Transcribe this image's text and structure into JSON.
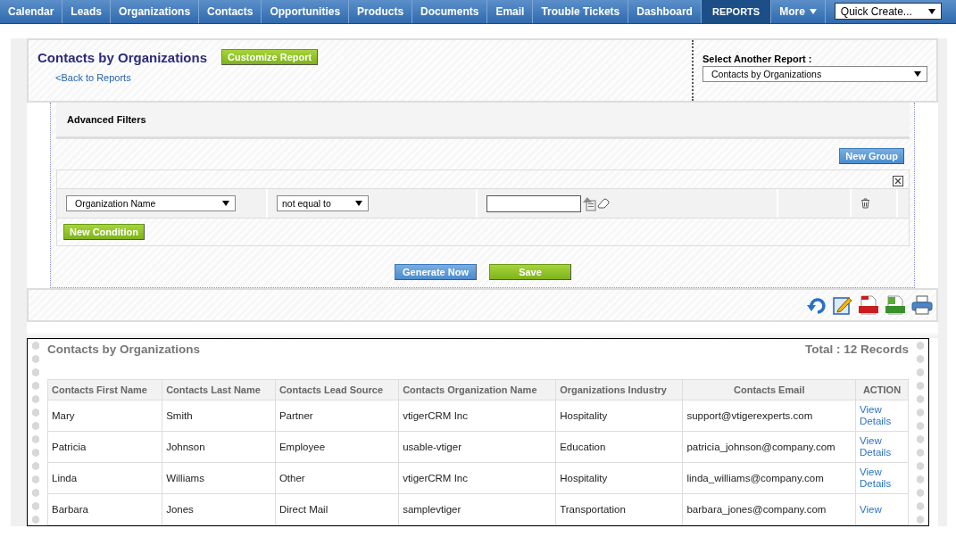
{
  "nav": {
    "items": [
      {
        "label": "Calendar",
        "selected": false
      },
      {
        "label": "Leads",
        "selected": false
      },
      {
        "label": "Organizations",
        "selected": false
      },
      {
        "label": "Contacts",
        "selected": false
      },
      {
        "label": "Opportunities",
        "selected": false
      },
      {
        "label": "Products",
        "selected": false
      },
      {
        "label": "Documents",
        "selected": false
      },
      {
        "label": "Email",
        "selected": false
      },
      {
        "label": "Trouble Tickets",
        "selected": false
      },
      {
        "label": "Dashboard",
        "selected": false
      },
      {
        "label": "REPORTS",
        "selected": true
      }
    ],
    "more": "More",
    "quick_create": "Quick Create..."
  },
  "report": {
    "title": "Contacts by Organizations",
    "customize_button": "Customize Report",
    "back_link": "<Back to Reports",
    "select_label": "Select Another Report :",
    "select_value": "Contacts by Organizations"
  },
  "filters": {
    "heading": "Advanced Filters",
    "new_group_button": "New Group",
    "conditions": [
      {
        "field": "Organization Name",
        "operator": "not equal to"
      }
    ],
    "new_condition_button": "New Condition",
    "generate_button": "Generate Now",
    "save_button": "Save"
  },
  "results": {
    "title": "Contacts by Organizations",
    "total": "Total : 12 Records",
    "columns": [
      "Contacts First Name",
      "Contacts Last Name",
      "Contacts Lead Source",
      "Contacts Organization Name",
      "Organizations Industry",
      "Contacts Email",
      "ACTION"
    ],
    "rows": [
      {
        "cells": [
          "Mary",
          "Smith",
          "Partner",
          "vtigerCRM Inc",
          "Hospitality",
          "support@vtigerexperts.com"
        ],
        "action": "View Details"
      },
      {
        "cells": [
          "Patricia",
          "Johnson",
          "Employee",
          "usable-vtiger",
          "Education",
          "patricia_johnson@company.com"
        ],
        "action": "View Details"
      },
      {
        "cells": [
          "Linda",
          "Williams",
          "Other",
          "vtigerCRM Inc",
          "Hospitality",
          "linda_williams@company.com"
        ],
        "action": "View Details"
      },
      {
        "cells": [
          "Barbara",
          "Jones",
          "Direct Mail",
          "samplevtiger",
          "Transportation",
          "barbara_jones@company.com"
        ],
        "action": "View"
      }
    ]
  }
}
